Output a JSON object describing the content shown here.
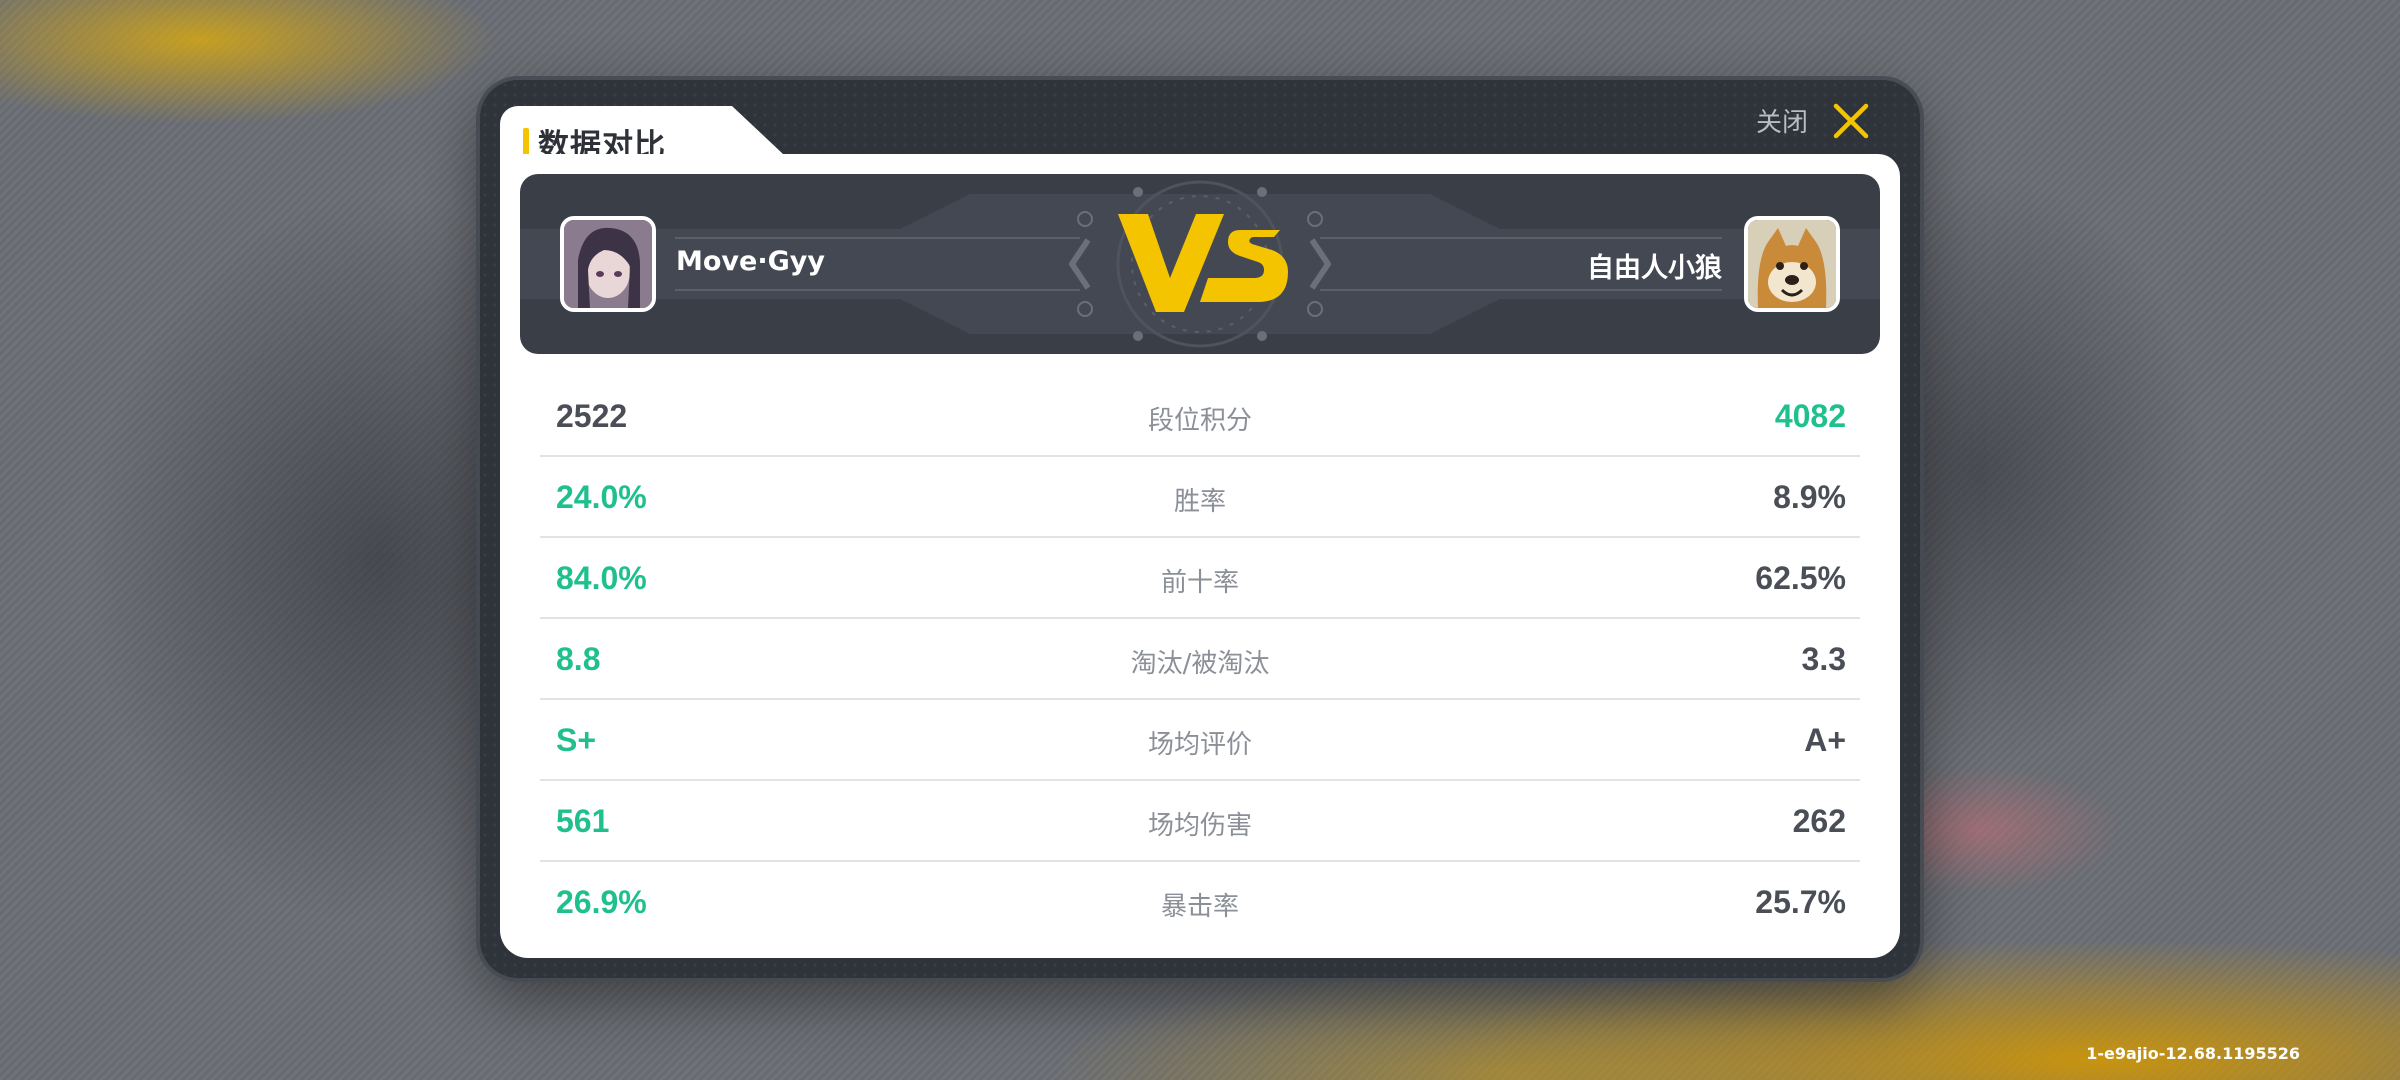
{
  "modal": {
    "title": "数据对比",
    "close_label": "关闭"
  },
  "players": {
    "left": {
      "name": "Move·Gyy"
    },
    "right": {
      "name": "自由人小狼"
    }
  },
  "vs_text": "VS",
  "stats": [
    {
      "label": "段位积分",
      "left": "2522",
      "right": "4082",
      "winner": "right"
    },
    {
      "label": "胜率",
      "left": "24.0%",
      "right": "8.9%",
      "winner": "left"
    },
    {
      "label": "前十率",
      "left": "84.0%",
      "right": "62.5%",
      "winner": "left"
    },
    {
      "label": "淘汰/被淘汰",
      "left": "8.8",
      "right": "3.3",
      "winner": "left"
    },
    {
      "label": "场均评价",
      "left": "S+",
      "right": "A+",
      "winner": "left"
    },
    {
      "label": "场均伤害",
      "left": "561",
      "right": "262",
      "winner": "left"
    },
    {
      "label": "暴击率",
      "left": "26.9%",
      "right": "25.7%",
      "winner": "left"
    }
  ],
  "version": "1-e9ajio-12.68.1195526",
  "colors": {
    "accent_yellow": "#f4c400",
    "winner_green": "#1fc08e",
    "neutral_gray": "#4a4e57"
  }
}
